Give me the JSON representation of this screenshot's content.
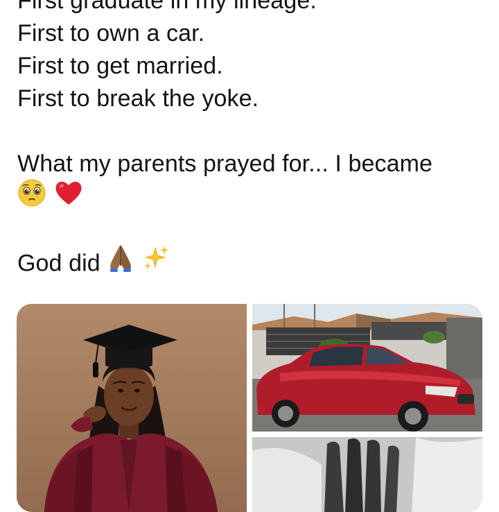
{
  "tweet": {
    "lines": [
      "First graduate in my lineage.",
      "First to own a car.",
      "First to get married.",
      "First to break the yoke."
    ],
    "sentence": "What my parents prayed for... I became",
    "closing": "God did"
  },
  "emojis": {
    "pleading": "pleading-face-emoji",
    "heart": "red-heart-emoji",
    "pray": "folded-hands-emoji",
    "sparkles": "sparkles-emoji"
  },
  "media": {
    "images": [
      "graduation-portrait-photo",
      "red-sedan-car-photo",
      "black-and-white-hands-photo"
    ]
  },
  "colors": {
    "text": "#0f1419",
    "background": "#ffffff",
    "heart": "#e0202f",
    "gown": "#7a1a2c"
  }
}
